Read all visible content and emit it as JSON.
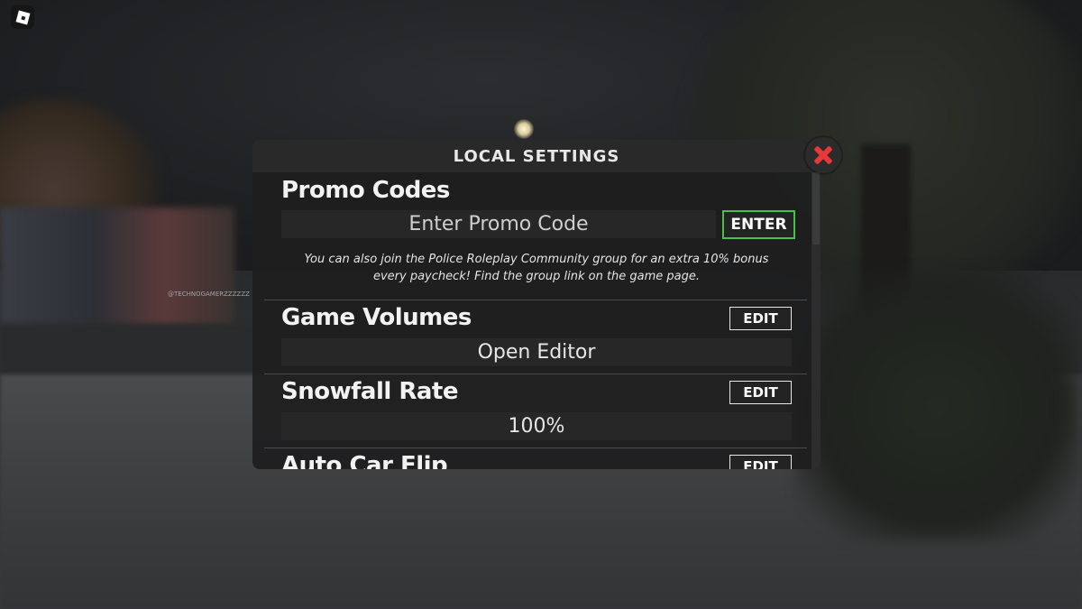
{
  "watermark": "@TECHNOGAMERZZZZZZ",
  "panel": {
    "title": "LOCAL SETTINGS",
    "promo": {
      "heading": "Promo Codes",
      "input_placeholder": "Enter Promo Code",
      "enter_label": "ENTER",
      "note": "You can also join the Police Roleplay Community group for an extra 10% bonus every paycheck! Find the group link on the game page."
    },
    "settings": [
      {
        "heading": "Game Volumes",
        "edit_label": "EDIT",
        "value": "Open Editor"
      },
      {
        "heading": "Snowfall Rate",
        "edit_label": "EDIT",
        "value": "100%"
      },
      {
        "heading": "Auto Car Flip",
        "edit_label": "EDIT",
        "value": ""
      }
    ]
  },
  "colors": {
    "enter_border": "#44c24a",
    "close_x": "#e8383a"
  },
  "icons": {
    "close": "close-icon",
    "logo": "roblox-logo"
  }
}
